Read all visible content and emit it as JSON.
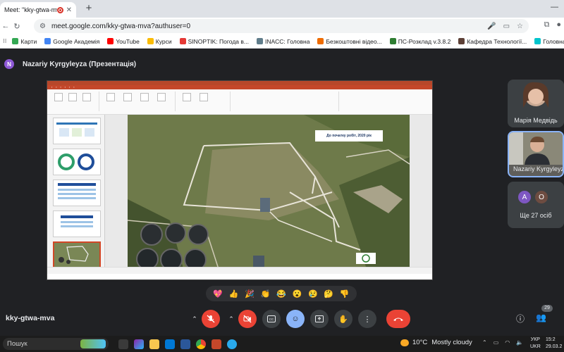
{
  "browser": {
    "tab_title": "Meet: \"kky-gtwa-mva\"",
    "new_tab": "+",
    "url": "meet.google.com/kky-gtwa-mva?authuser=0",
    "bookmarks": [
      {
        "label": "Карти",
        "color": "#34a853"
      },
      {
        "label": "Google Академія",
        "color": "#4285f4"
      },
      {
        "label": "YouTube",
        "color": "#ff0000"
      },
      {
        "label": "Курси",
        "color": "#fbbc04"
      },
      {
        "label": "SINOPTIK: Погода в...",
        "color": "#e53935"
      },
      {
        "label": "INACC: Головна",
        "color": "#607d8b"
      },
      {
        "label": "Безкоштовні відео...",
        "color": "#ef6c00"
      },
      {
        "label": "ПС-Розклад v.3.8.2",
        "color": "#2e7d32"
      },
      {
        "label": "Кафедра Технології...",
        "color": "#5d4037"
      },
      {
        "label": "Головна – Canva",
        "color": "#00c4cc"
      }
    ]
  },
  "meet": {
    "presenter_initial": "N",
    "presenter_label": "Nazariy Kyrgyleyza (Презентація)",
    "slide_caption": "До початку робіт, 2020 рік",
    "participants": [
      {
        "name": "Марія Медвідь"
      },
      {
        "name": "Nazariy Kyrgyleyza"
      }
    ],
    "others": {
      "initials": [
        "A",
        "O"
      ],
      "label": "Ще 27 осіб"
    },
    "meeting_code": "kky-gtwa-mva",
    "people_count": "29",
    "reactions": [
      "💖",
      "👍",
      "🎉",
      "👏",
      "😂",
      "😮",
      "😢",
      "🤔",
      "👎"
    ]
  },
  "taskbar": {
    "search_placeholder": "Пошук",
    "temperature": "10°C",
    "weather": "Mostly cloudy",
    "lang_line1": "УКР",
    "lang_line2": "UKR",
    "time": "15:2",
    "date": "29.03.2"
  },
  "colors": {
    "meet_bg": "#202124",
    "end_call": "#ea4335",
    "ppt_accent": "#c4472a"
  }
}
